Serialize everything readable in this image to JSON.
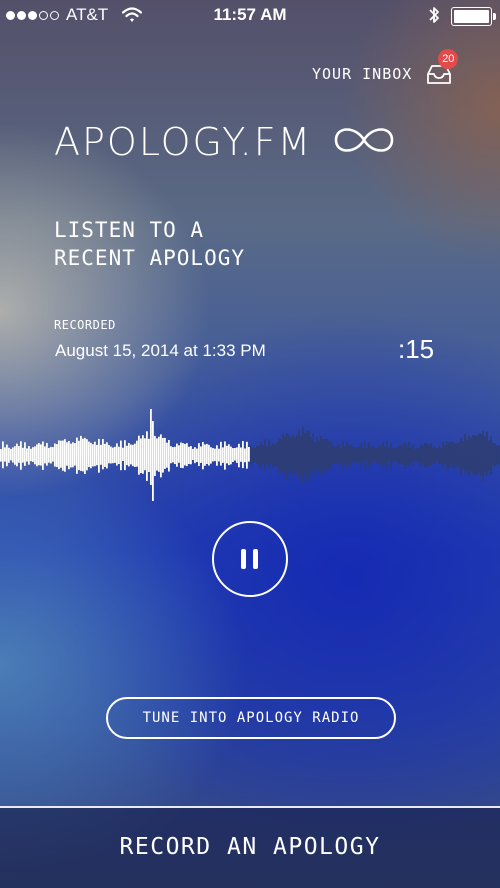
{
  "status_bar": {
    "carrier": "AT&T",
    "time": "11:57 AM",
    "signal_strength": 3,
    "signal_max": 5
  },
  "inbox": {
    "label": "YOUR INBOX",
    "badge_count": "20"
  },
  "brand": {
    "title": "APOLOGY.FM",
    "icon": "infinity-loop-icon"
  },
  "player": {
    "heading_line1": "LISTEN TO A",
    "heading_line2": "RECENT APOLOGY",
    "recorded_label": "RECORDED",
    "recorded_date": "August 15, 2014 at 1:33 PM",
    "duration": ":15",
    "progress": 0.5
  },
  "actions": {
    "tune_label": "TUNE INTO APOLOGY RADIO",
    "record_label": "RECORD AN APOLOGY"
  },
  "colors": {
    "badge": "#e24b4b",
    "played_wave": "#ffffff",
    "unplayed_wave": "#2c3d78"
  }
}
